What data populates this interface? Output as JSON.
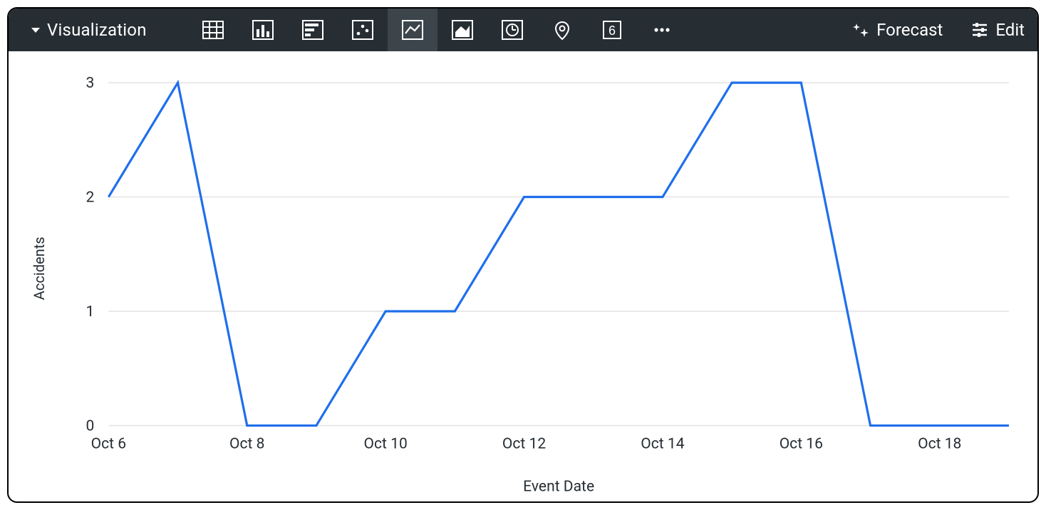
{
  "toolbar": {
    "title": "Visualization",
    "forecast_label": "Forecast",
    "edit_label": "Edit",
    "viz_types": [
      {
        "name": "table",
        "active": false
      },
      {
        "name": "column",
        "active": false
      },
      {
        "name": "bar-horizontal",
        "active": false
      },
      {
        "name": "scatter",
        "active": false
      },
      {
        "name": "line",
        "active": true
      },
      {
        "name": "area",
        "active": false
      },
      {
        "name": "timeline",
        "active": false
      },
      {
        "name": "map",
        "active": false
      },
      {
        "name": "single-value",
        "active": false
      },
      {
        "name": "more",
        "active": false
      }
    ]
  },
  "chart_data": {
    "type": "line",
    "xlabel": "Event Date",
    "ylabel": "Accidents",
    "x_ticks_shown": [
      "Oct 6",
      "Oct 8",
      "Oct 10",
      "Oct 12",
      "Oct 14",
      "Oct 16",
      "Oct 18"
    ],
    "categories": [
      "Oct 6",
      "Oct 7",
      "Oct 8",
      "Oct 9",
      "Oct 10",
      "Oct 11",
      "Oct 12",
      "Oct 13",
      "Oct 14",
      "Oct 15",
      "Oct 16",
      "Oct 17",
      "Oct 18",
      "Oct 19"
    ],
    "values": [
      2,
      3,
      0,
      0,
      1,
      1,
      2,
      2,
      2,
      3,
      3,
      0,
      0,
      0
    ],
    "ylim": [
      0,
      3
    ],
    "y_ticks": [
      0,
      1,
      2,
      3
    ]
  }
}
